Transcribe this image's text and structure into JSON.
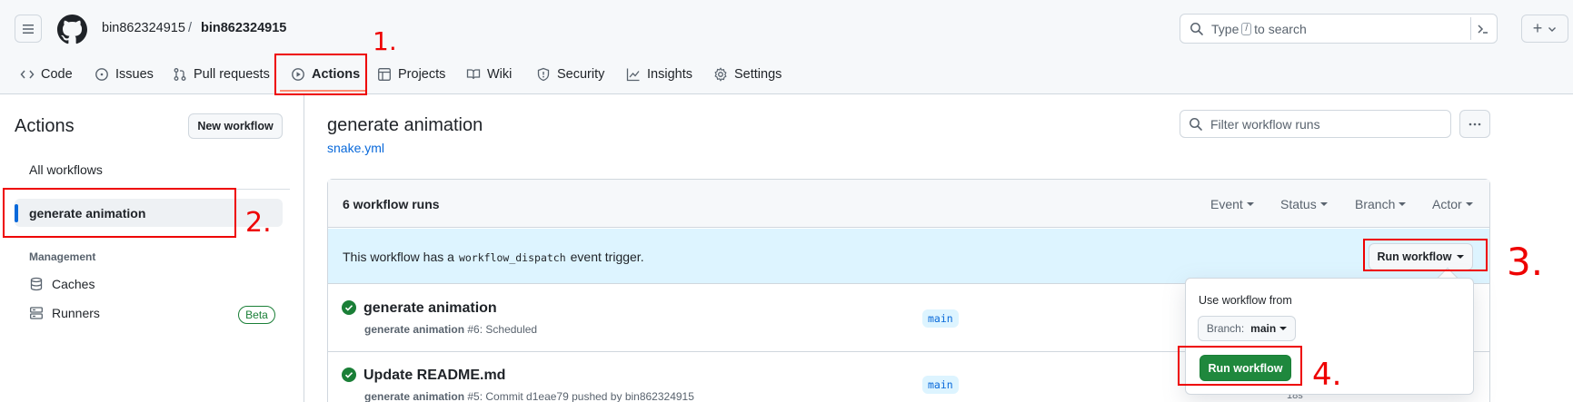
{
  "header": {
    "owner": "bin862324915",
    "separator": "/",
    "repo": "bin862324915",
    "search_prefix": "Type",
    "search_key": "/",
    "search_suffix": "to search",
    "plus": "+"
  },
  "nav_tabs": [
    {
      "label": "Code",
      "icon": "code-icon"
    },
    {
      "label": "Issues",
      "icon": "issue-icon"
    },
    {
      "label": "Pull requests",
      "icon": "pull-request-icon"
    },
    {
      "label": "Actions",
      "icon": "play-icon",
      "active": true
    },
    {
      "label": "Projects",
      "icon": "table-icon"
    },
    {
      "label": "Wiki",
      "icon": "book-icon"
    },
    {
      "label": "Security",
      "icon": "shield-icon"
    },
    {
      "label": "Insights",
      "icon": "graph-icon"
    },
    {
      "label": "Settings",
      "icon": "gear-icon"
    }
  ],
  "sidebar": {
    "title": "Actions",
    "new_workflow": "New workflow",
    "all_workflows": "All workflows",
    "selected_workflow": "generate animation",
    "management_heading": "Management",
    "caches": "Caches",
    "runners": "Runners",
    "runners_badge": "Beta"
  },
  "main": {
    "title": "generate animation",
    "file": "snake.yml",
    "filter_placeholder": "Filter workflow runs",
    "runs_count": "6 workflow runs",
    "filters": [
      "Event",
      "Status",
      "Branch",
      "Actor"
    ],
    "banner_prefix": "This workflow has a",
    "banner_code": "workflow_dispatch",
    "banner_suffix": "event trigger.",
    "run_workflow_button": "Run workflow",
    "runs": [
      {
        "title": "generate animation",
        "workflow": "generate animation",
        "meta": "#6: Scheduled",
        "branch": "main",
        "status_color": "#1a7f37"
      },
      {
        "title": "Update README.md",
        "workflow": "generate animation",
        "meta": "#5: Commit d1eae79 pushed by bin862324915",
        "branch": "main",
        "status_color": "#1a7f37"
      }
    ]
  },
  "dropdown": {
    "title": "Use workflow from",
    "branch_label": "Branch:",
    "branch_value": "main",
    "run_button": "Run workflow",
    "partial_text": "18s"
  },
  "annotations": [
    "1.",
    "2.",
    "3.",
    "4."
  ],
  "colors": {
    "annotation_red": "#ee0000",
    "accent_blue": "#0969da",
    "success_green": "#1f883d"
  }
}
